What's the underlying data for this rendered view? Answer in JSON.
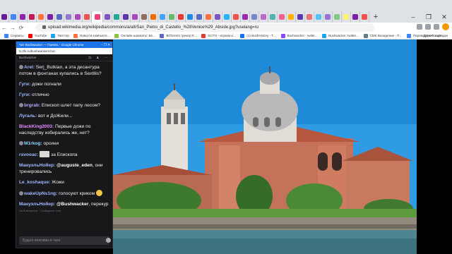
{
  "browser": {
    "url": "upload.wikimedia.org/wikipedia/commons/a/a8/San_Pietro_di_Castello_%28Venice%29_Abside.jpg?uselang=ru",
    "new_tab": "+",
    "win_min": "–",
    "win_max": "❐",
    "win_close": "✕",
    "back": "←",
    "forward": "→",
    "reload": "⟳",
    "tab_colors": [
      "#6a1b9a",
      "#4285f4",
      "#8e24aa",
      "#c2185b",
      "#ff7043",
      "#7b1fa2",
      "#5c6bc0",
      "#9575cd",
      "#ab47bc",
      "#ef5350",
      "#ec407a",
      "#7e57c2",
      "#26a69a",
      "#5e35b1",
      "#ab47bc",
      "#8d6e63",
      "#ef6c00",
      "#42a5f5",
      "#66bb6a",
      "#e53935",
      "#1e88e5",
      "#5c6bc0",
      "#ff7043",
      "#7e57c2",
      "#29b6f6",
      "#ef5350",
      "#9c27b0",
      "#7986cb",
      "#ba68c8",
      "#4db6ac",
      "#f06292",
      "#ffb300",
      "#5e35b1",
      "#e57373",
      "#4fc3f7",
      "#9575cd",
      "#81c784",
      "#fff176",
      "#7b1fa2",
      "#ef5350"
    ],
    "bookmarks": [
      {
        "label": "Сервисы",
        "color": "#4285f4"
      },
      {
        "label": "YouTube",
        "color": "#ff0000"
      },
      {
        "label": "Твиттер",
        "color": "#1da1f2"
      },
      {
        "label": "Новости компьюте…",
        "color": "#ff7043"
      },
      {
        "label": "Онлайн-шахматы: Бе…",
        "color": "#8bc34a"
      },
      {
        "label": "BitTorrent трекер R…",
        "color": "#5c6bc0"
      },
      {
        "label": "SCITX - играем и…",
        "color": "#e53935"
      },
      {
        "label": "(1) BushHistory - T…",
        "color": "#1a73e8"
      },
      {
        "label": "Bushwacker - twitte…",
        "color": "#9146ff"
      },
      {
        "label": "Bushwacker: twitter…",
        "color": "#1da1f2"
      },
      {
        "label": "CMK Вхождение - П…",
        "color": "#607d8b"
      },
      {
        "label": "Переводчик Google",
        "color": "#4285f4"
      }
    ],
    "other_bookmarks": "Другие закладки"
  },
  "popup": {
    "title": "Чат Bushwacker — Панель - Google Chrome",
    "controls": "– ❐ ✕",
    "url": "tv.2fs.ru/bushwacker/chat",
    "channel": "Bushwacker",
    "header_icons": "⇆ ♟ ⋯",
    "messages": [
      {
        "user": "Arel:",
        "color": "#9fb8ff",
        "badge": true,
        "text": " Serj_Butkian, а эта десантура потом в фонтанах купались в Sextilis?"
      },
      {
        "user": "Гуги:",
        "color": "#9fb8ff",
        "badge": false,
        "text": " дожи погнали"
      },
      {
        "user": "Гуги:",
        "color": "#9fb8ff",
        "badge": false,
        "text": " отлично"
      },
      {
        "user": "brgrab:",
        "color": "#b8a6ff",
        "badge": true,
        "text": " Епископ шлет папу лесом?"
      },
      {
        "user": "Лугаль:",
        "color": "#9fb8ff",
        "badge": false,
        "text": " вот и ДоЖили..."
      },
      {
        "user": "BlackKing2003:",
        "color": "#e08bff",
        "badge": false,
        "text": " Первые дожи по наследству избирались же, нет?"
      },
      {
        "user": "M1rkog:",
        "color": "#8ad6ff",
        "badge": true,
        "text": " орсини"
      },
      {
        "user": "rsvooac:",
        "color": "#9fb8ff",
        "badge": false,
        "text": " за Епископа",
        "emote_img": true
      },
      {
        "user": "МануэльНойер:",
        "color": "#9fb8ff",
        "badge": false,
        "mention": "@auguste_eden",
        "text": ", они тренировались"
      },
      {
        "user": "Le_koshaque:",
        "color": "#9fb8ff",
        "badge": false,
        "text": " Жожи"
      },
      {
        "user": "wakeUpNs1ng:",
        "color": "#9fb8ff",
        "badge": true,
        "text": " голосуют криком",
        "emote": true
      },
      {
        "user": "МануэльНойер:",
        "color": "#9fb8ff",
        "badge": false,
        "mention": "@Bushwacker",
        "text": ", перекур"
      }
    ],
    "footer_note": "via Bushwacker · Сообщение сети",
    "input_placeholder": "Будьте вежливы в чате"
  }
}
